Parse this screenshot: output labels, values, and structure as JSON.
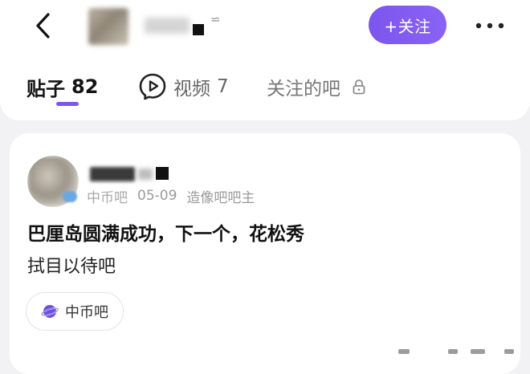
{
  "header": {
    "back_icon": "chevron-left-icon",
    "follow_label": "+关注",
    "more_icon": "more-horizontal-icon",
    "accent_color": "#7c55ee"
  },
  "tabs": [
    {
      "label": "贴子",
      "count": "82",
      "active": true
    },
    {
      "label": "视频",
      "count": "7",
      "icon": "video-play-icon",
      "active": false
    },
    {
      "label": "关注的吧",
      "icon": "lock-icon",
      "active": false
    }
  ],
  "post": {
    "forum": "中币吧",
    "date": "05-09",
    "role": "造像吧吧主",
    "title": "巴厘岛圆满成功，下一个，花松秀",
    "body": "拭目以待吧",
    "forum_tag_label": "中币吧",
    "forum_tag_icon": "planet-icon"
  }
}
